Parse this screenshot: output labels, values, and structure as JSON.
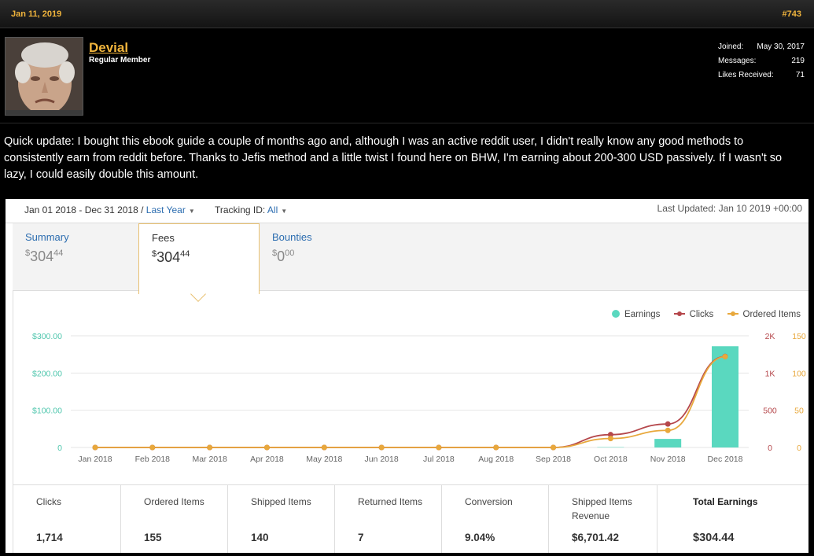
{
  "post": {
    "date": "Jan 11, 2019",
    "number": "#743"
  },
  "user": {
    "name": "Devial",
    "title": "Regular Member",
    "stats": [
      {
        "label": "Joined:",
        "value": "May 30, 2017"
      },
      {
        "label": "Messages:",
        "value": "219"
      },
      {
        "label": "Likes Received:",
        "value": "71"
      }
    ]
  },
  "body": "Quick update: I bought this ebook guide a couple of months ago and, although I was an active reddit user, I didn't really know any good methods to consistently earn from reddit before. Thanks to Jefis method and a little twist I found here on BHW, I'm earning about 200-300 USD passively. If I wasn't so lazy, I could easily double this amount.",
  "report": {
    "range_text": "Jan 01 2018 - Dec 31 2018 / ",
    "range_link": "Last Year",
    "tracking_label": "Tracking ID: ",
    "tracking_value": "All",
    "updated": "Last Updated: Jan 10 2019 +00:00",
    "tabs": [
      {
        "label": "Summary",
        "currency": "$",
        "whole": "304",
        "cents": "44"
      },
      {
        "label": "Fees",
        "currency": "$",
        "whole": "304",
        "cents": "44"
      },
      {
        "label": "Bounties",
        "currency": "$",
        "whole": "0",
        "cents": "00"
      }
    ],
    "metrics": [
      {
        "label": "Clicks",
        "value": "1,714"
      },
      {
        "label": "Ordered Items",
        "value": "155"
      },
      {
        "label": "Shipped Items",
        "value": "140"
      },
      {
        "label": "Returned Items",
        "value": "7"
      },
      {
        "label": "Conversion",
        "value": "9.04%"
      },
      {
        "label": "Shipped Items Revenue",
        "value": "$6,701.42"
      },
      {
        "label": "Total Earnings",
        "value": "$304.44"
      }
    ]
  },
  "colors": {
    "earnings": "#5ad8bf",
    "clicks": "#b5474b",
    "ordered": "#e8a83c",
    "accent": "#f0b43c"
  },
  "chart_data": {
    "type": "bar",
    "categories": [
      "Jan 2018",
      "Feb 2018",
      "Mar 2018",
      "Apr 2018",
      "May 2018",
      "Jun 2018",
      "Jul 2018",
      "Aug 2018",
      "Sep 2018",
      "Oct 2018",
      "Nov 2018",
      "Dec 2018"
    ],
    "series": [
      {
        "name": "Earnings",
        "axis": "left",
        "values": [
          0,
          0,
          0,
          0,
          0,
          0,
          0,
          0,
          0,
          1,
          23,
          272
        ]
      },
      {
        "name": "Clicks",
        "axis": "right1",
        "values": [
          0,
          0,
          0,
          0,
          0,
          0,
          0,
          0,
          0,
          230,
          420,
          1630
        ]
      },
      {
        "name": "Ordered Items",
        "axis": "right2",
        "values": [
          0,
          0,
          0,
          0,
          0,
          0,
          0,
          0,
          0,
          12,
          23,
          122
        ]
      }
    ],
    "y_left": {
      "min": 0,
      "max": 300,
      "ticks": [
        "0",
        "$100.00",
        "$200.00",
        "$300.00"
      ]
    },
    "y_right1": {
      "min": 0,
      "max": 2000,
      "ticks": [
        "0",
        "500",
        "1K",
        "2K"
      ]
    },
    "y_right2": {
      "min": 0,
      "max": 150,
      "ticks": [
        "0",
        "50",
        "100",
        "150"
      ]
    },
    "legend": [
      "Earnings",
      "Clicks",
      "Ordered Items"
    ],
    "legend_position": "top-right",
    "grid": true
  }
}
